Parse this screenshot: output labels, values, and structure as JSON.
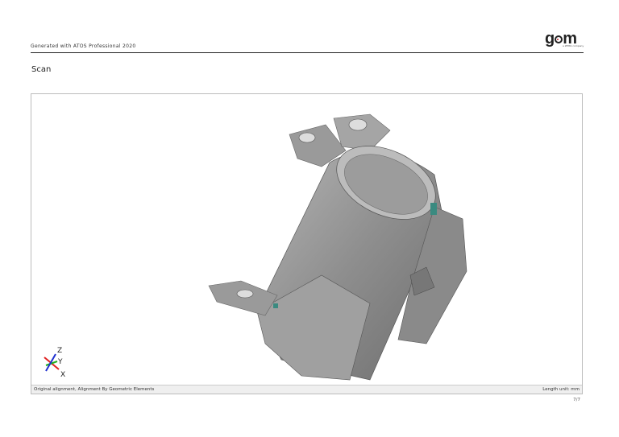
{
  "header": {
    "generated_text": "Generated with ATOS Professional 2020",
    "logo_text": "gom",
    "logo_subtext": "a ZEISS company"
  },
  "section_title": "Scan",
  "viewport": {
    "axes": {
      "z": "Z",
      "y": "Y",
      "x": "X"
    },
    "axis_colors": {
      "x": "#e02020",
      "y": "#20b020",
      "z": "#2030d0"
    },
    "status_left": "Original alignment, Alignment By Geometric Elements",
    "status_right": "Length unit: mm"
  },
  "footer": {
    "page_number": "7/7"
  }
}
